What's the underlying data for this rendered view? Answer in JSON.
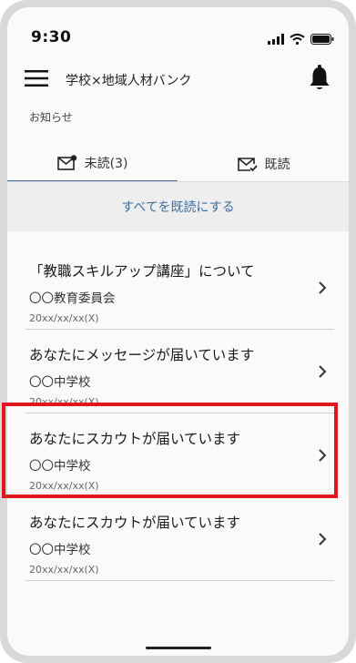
{
  "status_bar": {
    "time": "9:30"
  },
  "header": {
    "app_title": "学校×地域人材バンク"
  },
  "section_label": "お知らせ",
  "tabs": [
    {
      "label": "未読(3)",
      "icon": "mail-unread-icon",
      "selected": true
    },
    {
      "label": "既読",
      "icon": "mail-read-icon",
      "selected": false
    }
  ],
  "mark_all_label": "すべてを既読にする",
  "notifications": [
    {
      "title": "「教職スキルアップ講座」について",
      "sender": "〇〇教育委員会",
      "date": "20xx/xx/xx(X)"
    },
    {
      "title": "あなたにメッセージが届いています",
      "sender": "〇〇中学校",
      "date": "20xx/xx/xx(X)"
    },
    {
      "title": "あなたにスカウトが届いています",
      "sender": "〇〇中学校",
      "date": "20xx/xx/xx(X)",
      "highlighted": true
    },
    {
      "title": "あなたにスカウトが届いています",
      "sender": "〇〇中学校",
      "date": "20xx/xx/xx(X)"
    }
  ],
  "colors": {
    "accent": "#3c6e9c",
    "highlight": "#e0161e",
    "frame": "#d9d9d9"
  }
}
